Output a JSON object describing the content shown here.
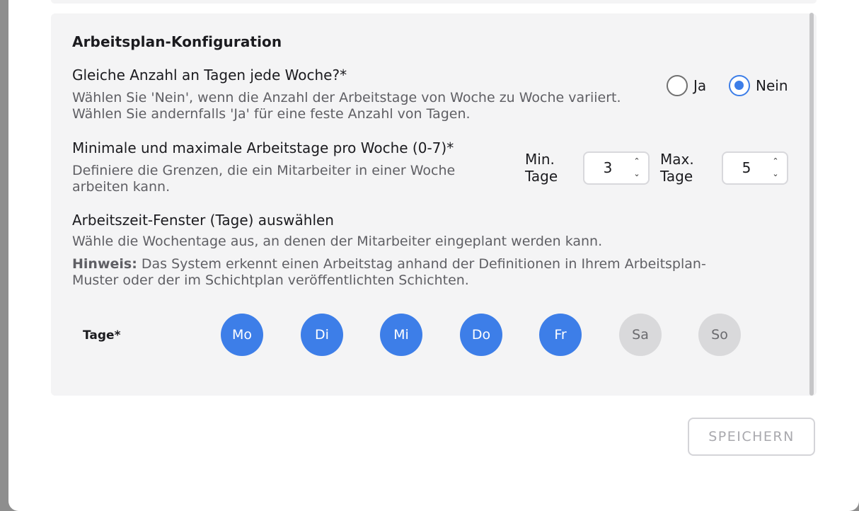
{
  "config": {
    "title": "Arbeitsplan-Konfiguration",
    "same_days": {
      "label": "Gleiche Anzahl an Tagen jede Woche?*",
      "description": "Wählen Sie 'Nein', wenn die Anzahl der Arbeitstage von Woche zu Woche variiert. Wählen Sie andernfalls 'Ja' für eine feste Anzahl von Tagen.",
      "options": [
        {
          "label": "Ja",
          "checked": false
        },
        {
          "label": "Nein",
          "checked": true
        }
      ]
    },
    "min_max": {
      "label": "Minimale und maximale Arbeitstage pro Woche (0-7)*",
      "description": "Definiere die Grenzen, die ein Mitarbeiter in einer Woche arbeiten kann.",
      "min_label_1": "Min.",
      "min_label_2": "Tage",
      "min_value": "3",
      "max_label_1": "Max.",
      "max_label_2": "Tage",
      "max_value": "5",
      "arrow_up": "⌃",
      "arrow_down": "⌄"
    },
    "window": {
      "label": "Arbeitszeit-Fenster (Tage) auswählen",
      "description": "Wähle die Wochentage aus, an denen der Mitarbeiter eingeplant werden kann.",
      "note_bold": "Hinweis:",
      "note_text": " Das System erkennt einen Arbeitstag anhand der Definitionen in Ihrem Arbeitsplan-Muster oder der im Schichtplan veröffentlichten Schichten."
    },
    "days_label": "Tage*",
    "days": [
      {
        "label": "Mo",
        "selected": true
      },
      {
        "label": "Di",
        "selected": true
      },
      {
        "label": "Mi",
        "selected": true
      },
      {
        "label": "Do",
        "selected": true
      },
      {
        "label": "Fr",
        "selected": true
      },
      {
        "label": "Sa",
        "selected": false
      },
      {
        "label": "So",
        "selected": false
      }
    ]
  },
  "save_label": "SPEICHERN",
  "colors": {
    "accent": "#3d7ee8",
    "day_off": "#d9d9db",
    "card_bg": "#f4f4f5"
  }
}
